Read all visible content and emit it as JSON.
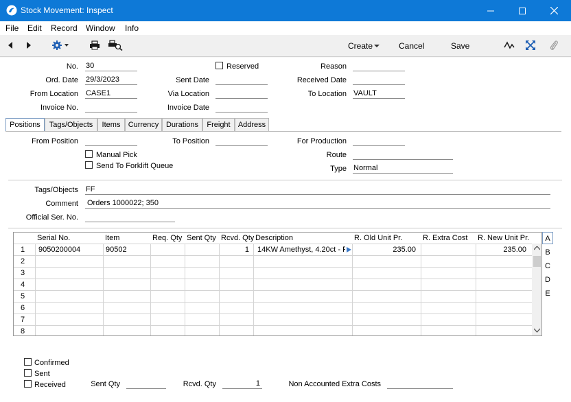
{
  "window": {
    "title": "Stock Movement: Inspect",
    "minimize_glyph": "—",
    "maximize_glyph": "☐",
    "close_glyph": "✕"
  },
  "menu": [
    "File",
    "Edit",
    "Record",
    "Window",
    "Info"
  ],
  "toolbar": {
    "create_label": "Create",
    "cancel_label": "Cancel",
    "save_label": "Save"
  },
  "header": {
    "no_label": "No.",
    "no_value": "30",
    "reserved_label": "Reserved",
    "reason_label": "Reason",
    "reason_value": "",
    "ord_date_label": "Ord. Date",
    "ord_date_value": "29/3/2023",
    "sent_date_label": "Sent Date",
    "sent_date_value": "",
    "received_date_label": "Received Date",
    "received_date_value": "",
    "from_location_label": "From Location",
    "from_location_value": "CASE1",
    "via_location_label": "Via Location",
    "via_location_value": "",
    "to_location_label": "To Location",
    "to_location_value": "VAULT",
    "invoice_no_label": "Invoice No.",
    "invoice_no_value": "",
    "invoice_date_label": "Invoice Date",
    "invoice_date_value": ""
  },
  "tabs": [
    "Positions",
    "Tags/Objects",
    "Items",
    "Currency",
    "Durations",
    "Freight",
    "Address"
  ],
  "positions": {
    "from_position_label": "From Position",
    "from_position_value": "",
    "to_position_label": "To Position",
    "to_position_value": "",
    "for_production_label": "For Production",
    "for_production_value": "",
    "manual_pick_label": "Manual Pick",
    "forklift_label": "Send To Forklift Queue",
    "route_label": "Route",
    "route_value": "",
    "type_label": "Type",
    "type_value": "Normal"
  },
  "extra": {
    "tags_label": "Tags/Objects",
    "tags_value": "FF",
    "comment_label": "Comment",
    "comment_value": "Orders 1000022; 350",
    "official_label": "Official Ser. No.",
    "official_value": ""
  },
  "grid": {
    "columns": [
      "Serial No.",
      "Item",
      "Req. Qty",
      "Sent Qty",
      "Rcvd. Qty",
      "Description",
      "R. Old Unit Pr.",
      "R. Extra Cost",
      "R. New Unit Pr."
    ],
    "row_numbers": [
      "1",
      "2",
      "3",
      "4",
      "5",
      "6",
      "7",
      "8"
    ],
    "rows": [
      {
        "serial": "9050200004",
        "item": "90502",
        "req": "",
        "sent": "",
        "rcvd": "1",
        "desc": "14KW Amethyst, 4.20ct - P",
        "old": "235.00",
        "extra": "",
        "new": "235.00"
      }
    ],
    "side_tabs": [
      "A",
      "B",
      "C",
      "D",
      "E"
    ]
  },
  "footer": {
    "confirmed_label": "Confirmed",
    "sent_label": "Sent",
    "received_label": "Received",
    "sent_qty_label": "Sent Qty",
    "sent_qty_value": "",
    "rcvd_qty_label": "Rcvd. Qty",
    "rcvd_qty_value": "1",
    "non_accounted_label": "Non Accounted Extra Costs",
    "non_accounted_value": ""
  },
  "colors": {
    "titlebar": "#0e79d7",
    "accent": "#1f5fb4"
  }
}
